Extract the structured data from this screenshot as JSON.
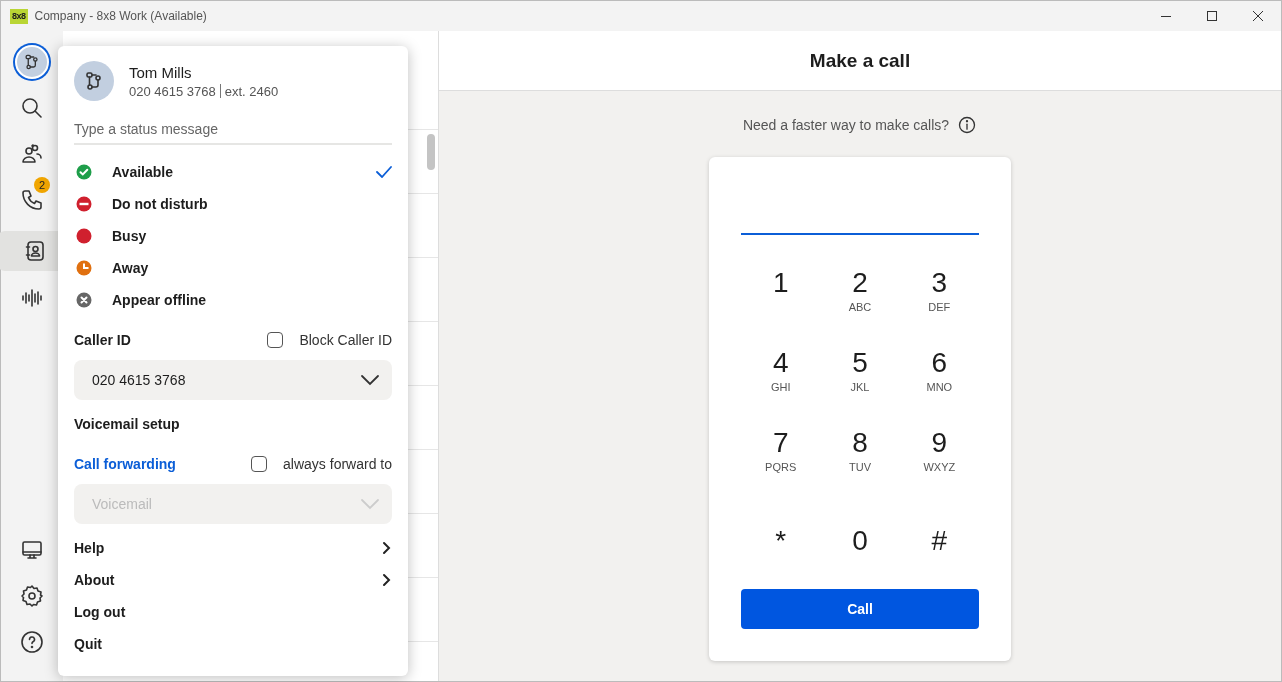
{
  "window": {
    "title": "Company - 8x8 Work (Available)",
    "logo": "8x8"
  },
  "rail": {
    "top": [
      {
        "kind": "avatar",
        "selected": false
      },
      {
        "kind": "search",
        "selected": false
      },
      {
        "kind": "people",
        "selected": false
      },
      {
        "kind": "phone",
        "selected": false,
        "badge": "2"
      },
      {
        "kind": "contacts",
        "selected": true
      },
      {
        "kind": "voice",
        "selected": false
      }
    ],
    "bottom": [
      {
        "kind": "desktop",
        "selected": false
      },
      {
        "kind": "settings",
        "selected": false
      },
      {
        "kind": "help",
        "selected": false
      }
    ]
  },
  "profile_menu": {
    "name": "Tom Mills",
    "phone": "020 4615 3768",
    "extension": "ext. 2460",
    "status_placeholder": "Type a status message",
    "statuses": [
      {
        "kind": "check",
        "label": "Available",
        "color": "#1e9e4a",
        "selected": true
      },
      {
        "kind": "minus",
        "label": "Do not disturb",
        "color": "#d0202e",
        "selected": false
      },
      {
        "kind": "dot",
        "label": "Busy",
        "color": "#d0202e",
        "selected": false
      },
      {
        "kind": "clock",
        "label": "Away",
        "color": "#e07010",
        "selected": false
      },
      {
        "kind": "cross",
        "label": "Appear offline",
        "color": "#666666",
        "selected": false
      }
    ],
    "caller_id": {
      "label": "Caller ID",
      "block_label": "Block Caller ID",
      "block_checked": false,
      "value": "020 4615 3768"
    },
    "voicemail_setup": "Voicemail setup",
    "call_forwarding": {
      "label": "Call forwarding",
      "checkbox_label": "always forward to",
      "checked": false,
      "value": "Voicemail",
      "disabled": true
    },
    "menu_items": [
      {
        "label": "Help",
        "submenu": true
      },
      {
        "label": "About",
        "submenu": true
      },
      {
        "label": "Log out",
        "submenu": false
      },
      {
        "label": "Quit",
        "submenu": false
      }
    ]
  },
  "main": {
    "title": "Make a call",
    "hint": "Need a faster way to make calls?",
    "keys": [
      {
        "digit": "1"
      },
      {
        "digit": "2",
        "letters": "ABC"
      },
      {
        "digit": "3",
        "letters": "DEF"
      },
      {
        "digit": "4",
        "letters": "GHI"
      },
      {
        "digit": "5",
        "letters": "JKL"
      },
      {
        "digit": "6",
        "letters": "MNO"
      },
      {
        "digit": "7",
        "letters": "PQRS"
      },
      {
        "digit": "8",
        "letters": "TUV"
      },
      {
        "digit": "9",
        "letters": "WXYZ"
      },
      {
        "digit": "*"
      },
      {
        "digit": "0"
      },
      {
        "digit": "#"
      }
    ],
    "call_button": "Call"
  }
}
